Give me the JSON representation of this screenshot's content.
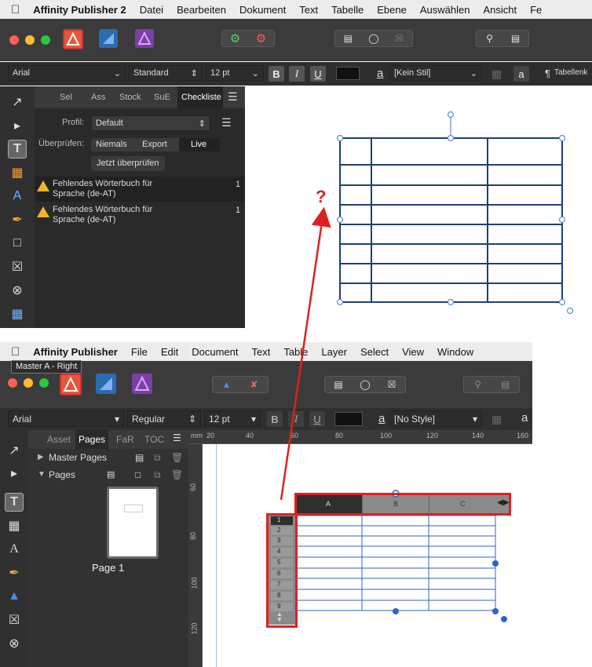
{
  "top": {
    "menu": [
      "Affinity Publisher 2",
      "Datei",
      "Bearbeiten",
      "Dokument",
      "Text",
      "Tabelle",
      "Ebene",
      "Auswählen",
      "Ansicht",
      "Fe"
    ],
    "context": {
      "font": "Arial",
      "style": "Standard",
      "size": "12 pt",
      "bold": "B",
      "italic": "I",
      "underline": "U",
      "char_style": "[Kein Stil]",
      "table_label": "Tabellenk"
    },
    "panel": {
      "tabs": [
        "Sel",
        "Ass",
        "Stock",
        "SuE",
        "Checkliste"
      ],
      "profile_label": "Profil:",
      "profile_value": "Default",
      "check_label": "Überprüfen:",
      "check_options": [
        "Niemals",
        "Export",
        "Live"
      ],
      "check_now": "Jetzt überprüfen",
      "issues": [
        {
          "text": "Fehlendes Wörterbuch für Sprache (de-AT)",
          "count": "1"
        },
        {
          "text": "Fehlendes Wörterbuch für Sprache (de-AT)",
          "count": "1"
        }
      ]
    },
    "annotation": "?"
  },
  "bottom": {
    "menu": [
      "Affinity Publisher",
      "File",
      "Edit",
      "Document",
      "Text",
      "Table",
      "Layer",
      "Select",
      "View",
      "Window"
    ],
    "tooltip": "Master A - Right",
    "context": {
      "font": "Arial",
      "style": "Regular",
      "size": "12 pt",
      "bold": "B",
      "italic": "I",
      "underline": "U",
      "char_style": "[No Style]"
    },
    "panel": {
      "tabs": [
        "Asset",
        "Pages",
        "FaR",
        "TOC"
      ],
      "master_pages": "Master Pages",
      "pages": "Pages",
      "page1": "Page 1"
    },
    "ruler": {
      "h": [
        "mm",
        "20",
        "40",
        "60",
        "80",
        "100",
        "120",
        "140",
        "160"
      ],
      "v": [
        "60",
        "80",
        "100",
        "120"
      ]
    },
    "table": {
      "columns": [
        "A",
        "B",
        "C"
      ],
      "rows": [
        "1",
        "2",
        "3",
        "4",
        "5",
        "6",
        "7",
        "8",
        "9"
      ]
    }
  },
  "colors": {
    "accent_red": "#e02020",
    "table_blue_top": "#1f3d7a",
    "table_blue_bottom": "#2a64c8",
    "app_orange": "#e8553a"
  }
}
